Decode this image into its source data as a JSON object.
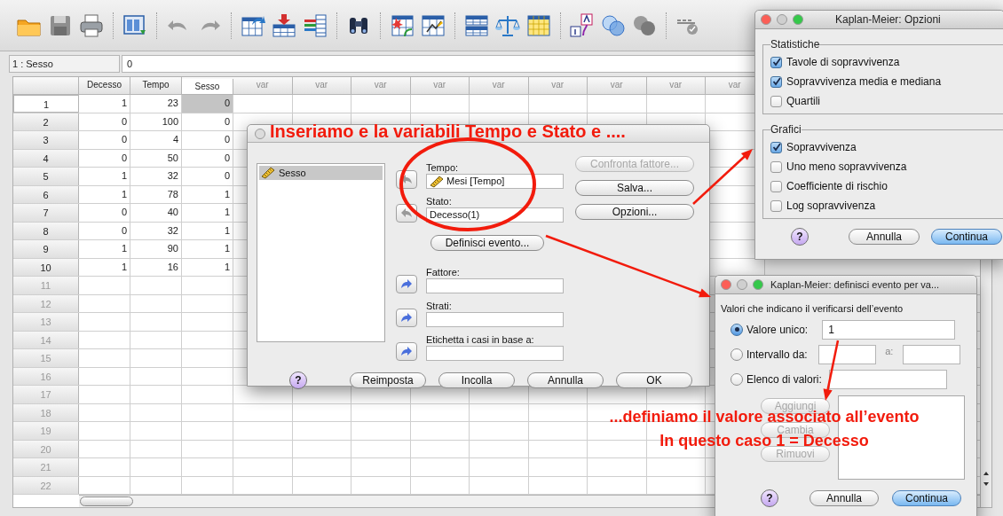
{
  "cell_bar": {
    "reference": "1 : Sesso",
    "value": "0"
  },
  "grid": {
    "columns": [
      {
        "label": "Decesso",
        "kind": "variable",
        "selected": false
      },
      {
        "label": "Tempo",
        "kind": "variable",
        "selected": false
      },
      {
        "label": "Sesso",
        "kind": "variable",
        "selected": true
      },
      {
        "label": "var",
        "kind": "empty",
        "selected": false
      },
      {
        "label": "var",
        "kind": "empty",
        "selected": false
      },
      {
        "label": "var",
        "kind": "empty",
        "selected": false
      },
      {
        "label": "var",
        "kind": "empty",
        "selected": false
      },
      {
        "label": "var",
        "kind": "empty",
        "selected": false
      },
      {
        "label": "var",
        "kind": "empty",
        "selected": false
      },
      {
        "label": "var",
        "kind": "empty",
        "selected": false
      },
      {
        "label": "var",
        "kind": "empty",
        "selected": false
      },
      {
        "label": "var",
        "kind": "empty",
        "selected": false
      }
    ],
    "rows": [
      {
        "number": "1",
        "selected": true,
        "disabled": false,
        "cells": [
          "1",
          "23",
          "0"
        ]
      },
      {
        "number": "2",
        "selected": false,
        "disabled": false,
        "cells": [
          "0",
          "100",
          "0"
        ]
      },
      {
        "number": "3",
        "selected": false,
        "disabled": false,
        "cells": [
          "0",
          "4",
          "0"
        ]
      },
      {
        "number": "4",
        "selected": false,
        "disabled": false,
        "cells": [
          "0",
          "50",
          "0"
        ]
      },
      {
        "number": "5",
        "selected": false,
        "disabled": false,
        "cells": [
          "1",
          "32",
          "0"
        ]
      },
      {
        "number": "6",
        "selected": false,
        "disabled": false,
        "cells": [
          "1",
          "78",
          "1"
        ]
      },
      {
        "number": "7",
        "selected": false,
        "disabled": false,
        "cells": [
          "0",
          "40",
          "1"
        ]
      },
      {
        "number": "8",
        "selected": false,
        "disabled": false,
        "cells": [
          "0",
          "32",
          "1"
        ]
      },
      {
        "number": "9",
        "selected": false,
        "disabled": false,
        "cells": [
          "1",
          "90",
          "1"
        ]
      },
      {
        "number": "10",
        "selected": false,
        "disabled": false,
        "cells": [
          "1",
          "16",
          "1"
        ]
      },
      {
        "number": "11",
        "selected": false,
        "disabled": true
      },
      {
        "number": "12",
        "selected": false,
        "disabled": true
      },
      {
        "number": "13",
        "selected": false,
        "disabled": true
      },
      {
        "number": "14",
        "selected": false,
        "disabled": true
      },
      {
        "number": "15",
        "selected": false,
        "disabled": true
      },
      {
        "number": "16",
        "selected": false,
        "disabled": true
      },
      {
        "number": "17",
        "selected": false,
        "disabled": true
      },
      {
        "number": "18",
        "selected": false,
        "disabled": true
      },
      {
        "number": "19",
        "selected": false,
        "disabled": true
      },
      {
        "number": "20",
        "selected": false,
        "disabled": true
      },
      {
        "number": "21",
        "selected": false,
        "disabled": true
      },
      {
        "number": "22",
        "selected": false,
        "disabled": true
      }
    ]
  },
  "main_dialog": {
    "active": false,
    "variables": [
      {
        "label": "Sesso",
        "selected": true
      }
    ],
    "targets": [
      {
        "label": "Tempo:",
        "value": "Mesi [Tempo]",
        "kind": "scale",
        "arrow_disabled": true
      },
      {
        "label": "Stato:",
        "value": "Decesso(1)",
        "kind": "plain",
        "arrow_disabled": true
      },
      {
        "label": "Fattore:",
        "kind": "plain",
        "arrow_disabled": false
      },
      {
        "label": "Strati:",
        "kind": "plain",
        "arrow_disabled": false
      },
      {
        "label": "Etichetta i casi in base a:",
        "kind": "plain",
        "arrow_disabled": false
      }
    ],
    "event_button": "Definisci evento...",
    "side_buttons": [
      {
        "label": "Confronta fattore...",
        "disabled": true
      },
      {
        "label": "Salva...",
        "disabled": false
      },
      {
        "label": "Opzioni...",
        "disabled": false
      }
    ],
    "help": "?",
    "buttons": [
      "Reimposta",
      "Incolla",
      "Annulla",
      "OK"
    ]
  },
  "options_dialog": {
    "active": true,
    "title": "Kaplan-Meier: Opzioni",
    "groups": [
      {
        "title": "Statistiche",
        "options": [
          {
            "label": "Tavole di sopravvivenza",
            "checked": true
          },
          {
            "label": "Sopravvivenza media e mediana",
            "checked": true
          },
          {
            "label": "Quartili",
            "checked": false
          }
        ]
      },
      {
        "title": "Grafici",
        "options": [
          {
            "label": "Sopravvivenza",
            "checked": true
          },
          {
            "label": "Uno meno sopravvivenza",
            "checked": false
          },
          {
            "label": "Coefficiente di rischio",
            "checked": false
          },
          {
            "label": "Log sopravvivenza",
            "checked": false
          }
        ]
      }
    ],
    "help": "?",
    "buttons": [
      {
        "label": "Annulla",
        "default": false
      },
      {
        "label": "Continua",
        "default": true
      }
    ]
  },
  "event_dialog": {
    "active": true,
    "title": "Kaplan-Meier: definisci evento per va...",
    "prompt": "Valori che indicano il verificarsi dell’evento",
    "choices": [
      {
        "label": "Valore unico:",
        "kind": "single",
        "selected": true,
        "value": "1"
      },
      {
        "label": "Intervallo da:",
        "kind": "range",
        "selected": false,
        "separator": "a:"
      },
      {
        "label": "Elenco di valori:",
        "kind": "list",
        "selected": false
      }
    ],
    "list_buttons": [
      {
        "label": "Aggiungi",
        "disabled": true
      },
      {
        "label": "Cambia",
        "disabled": true
      },
      {
        "label": "Rimuovi",
        "disabled": true
      }
    ],
    "help": "?",
    "buttons": [
      {
        "label": "Annulla",
        "default": false
      },
      {
        "label": "Continua",
        "default": true
      }
    ]
  },
  "annotations": {
    "top": "Inseriamo e la variabili Tempo e Stato e ....",
    "bottom": [
      "...definiamo il valore associato all’evento",
      "In questo caso 1 = Decesso"
    ]
  }
}
